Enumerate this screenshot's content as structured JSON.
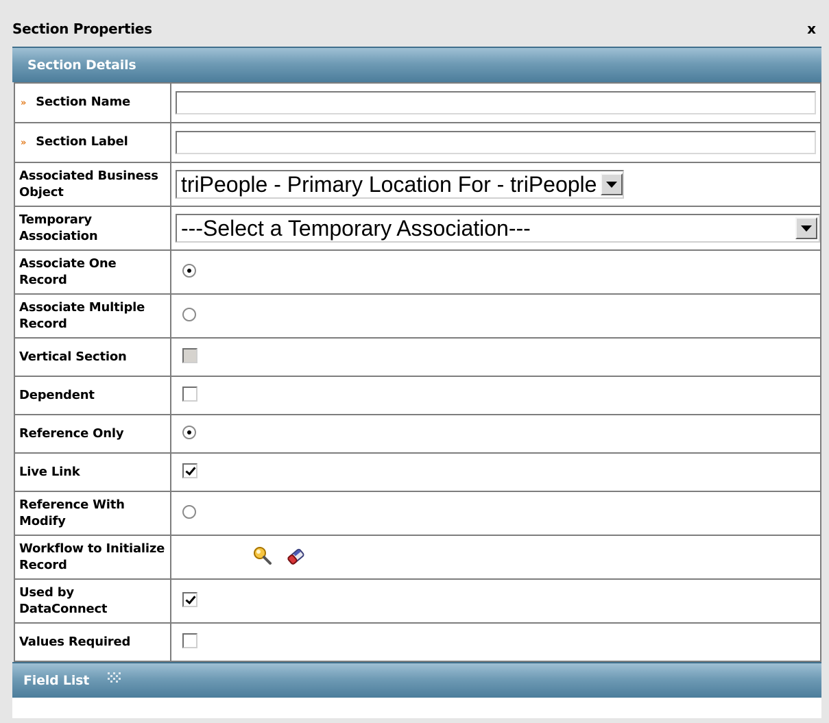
{
  "dialog": {
    "title": "Section Properties",
    "close_label": "x"
  },
  "section_details": {
    "header": "Section Details",
    "fields": {
      "section_name": {
        "label": "Section Name",
        "required": true,
        "required_marker": "»",
        "value": ""
      },
      "section_label": {
        "label": "Section Label",
        "required": true,
        "required_marker": "»",
        "value": ""
      },
      "associated_business_object": {
        "label": "Associated Business Object",
        "selected": "triPeople - Primary Location For - triPeople"
      },
      "temporary_association": {
        "label": "Temporary Association",
        "selected": "---Select a Temporary Association---"
      },
      "associate_one_record": {
        "label": "Associate One Record",
        "checked": true
      },
      "associate_multiple_record": {
        "label": "Associate Multiple Record",
        "checked": false
      },
      "vertical_section": {
        "label": "Vertical Section",
        "checked": false,
        "disabled": true
      },
      "dependent": {
        "label": "Dependent",
        "checked": false
      },
      "reference_only": {
        "label": "Reference Only",
        "checked": true
      },
      "live_link": {
        "label": "Live Link",
        "checked": true
      },
      "reference_with_modify": {
        "label": "Reference With Modify",
        "checked": false
      },
      "workflow_to_initialize_record": {
        "label": "Workflow to Initialize Record",
        "icons": [
          "search-icon",
          "eraser-icon"
        ]
      },
      "used_by_dataconnect": {
        "label": "Used by DataConnect",
        "checked": true
      },
      "values_required": {
        "label": "Values Required",
        "checked": false
      }
    }
  },
  "field_list": {
    "header": "Field List",
    "icon": "drag-grip-icon"
  },
  "colors": {
    "header_gradient_top": "#9fc0d4",
    "header_gradient_bottom": "#4c7d9b",
    "required_marker": "#e27a1b",
    "background": "#e6e6e6"
  }
}
